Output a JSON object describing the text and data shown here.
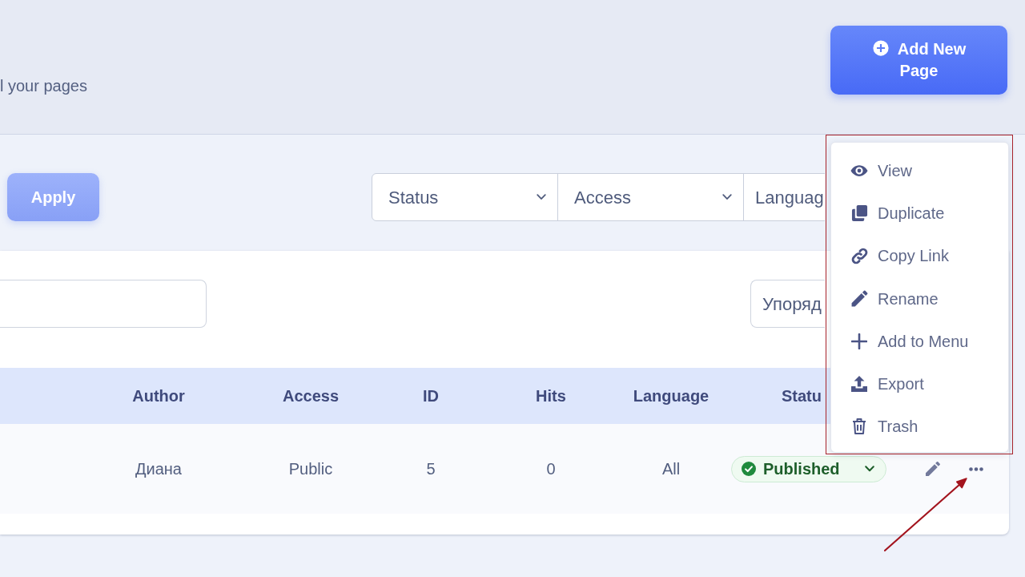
{
  "page_header": {
    "subtitle": "l your pages",
    "add_button": "Add New Page"
  },
  "filters": {
    "apply_button": "Apply",
    "selects": [
      {
        "label": "Status",
        "truncated": false
      },
      {
        "label": "Access",
        "truncated": false
      },
      {
        "label": "Languag",
        "truncated": true
      }
    ]
  },
  "list_tools": {
    "search_field": {
      "shown": true
    },
    "sort_select": {
      "label": "Упоряд",
      "truncated": true
    }
  },
  "table": {
    "columns": [
      "Author",
      "Access",
      "ID",
      "Hits",
      "Language",
      "Statu"
    ],
    "rows": [
      {
        "cells": [
          "Диана",
          "Public",
          "5",
          "0",
          "All"
        ],
        "status": "Published"
      }
    ]
  },
  "row_menu": {
    "items": [
      "View",
      "Duplicate",
      "Copy Link",
      "Rename",
      "Add to Menu",
      "Export",
      "Trash"
    ]
  },
  "annotation": {
    "highlight_frame": true,
    "pointer_arrow": true
  }
}
